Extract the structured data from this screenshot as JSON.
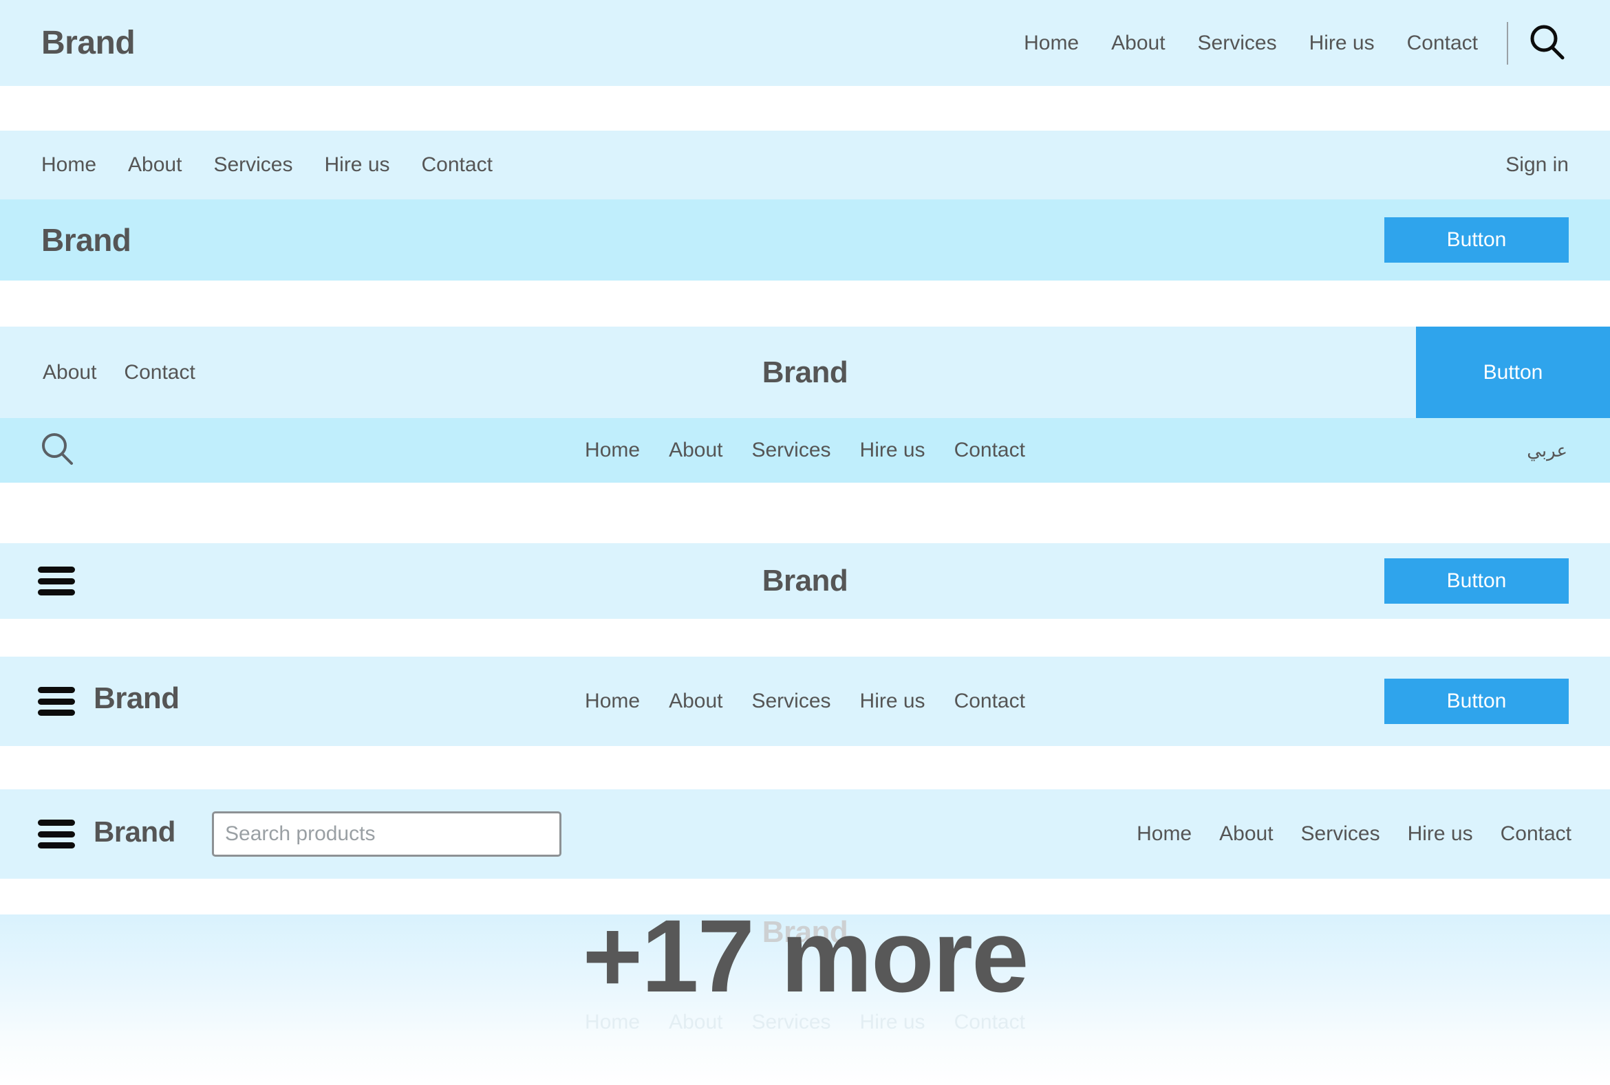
{
  "colors": {
    "band_light": "#dbf3fd",
    "band_dark": "#c0eefc",
    "accent_button": "#2fa4ec",
    "text": "#555555",
    "icon_dark": "#0c0c0c"
  },
  "common": {
    "brand": "Brand",
    "button_label": "Button",
    "nav_full": [
      "Home",
      "About",
      "Services",
      "Hire us",
      "Contact"
    ]
  },
  "band1": {
    "brand": "Brand",
    "nav": [
      "Home",
      "About",
      "Services",
      "Hire us",
      "Contact"
    ],
    "search_icon": "search-icon"
  },
  "band2": {
    "nav": [
      "Home",
      "About",
      "Services",
      "Hire us",
      "Contact"
    ],
    "signin": "Sign in"
  },
  "band3": {
    "brand": "Brand",
    "button_label": "Button"
  },
  "band4": {
    "left_nav": [
      "About",
      "Contact"
    ],
    "brand": "Brand",
    "button_label": "Button",
    "search_icon": "search-icon",
    "nav": [
      "Home",
      "About",
      "Services",
      "Hire us",
      "Contact"
    ],
    "language_toggle": "عربي"
  },
  "band5": {
    "menu_icon": "hamburger-menu-icon",
    "brand": "Brand",
    "button_label": "Button"
  },
  "band6": {
    "menu_icon": "hamburger-menu-icon",
    "brand": "Brand",
    "nav": [
      "Home",
      "About",
      "Services",
      "Hire us",
      "Contact"
    ],
    "button_label": "Button"
  },
  "band7": {
    "menu_icon": "hamburger-menu-icon",
    "brand": "Brand",
    "search_placeholder": "Search products",
    "search_value": "",
    "nav": [
      "Home",
      "About",
      "Services",
      "Hire us",
      "Contact"
    ]
  },
  "band8": {
    "brand": "Brand",
    "nav": [
      "Home",
      "About",
      "Services",
      "Hire us",
      "Contact"
    ]
  },
  "overlay": {
    "more_label": "+17 more",
    "count": 17
  }
}
